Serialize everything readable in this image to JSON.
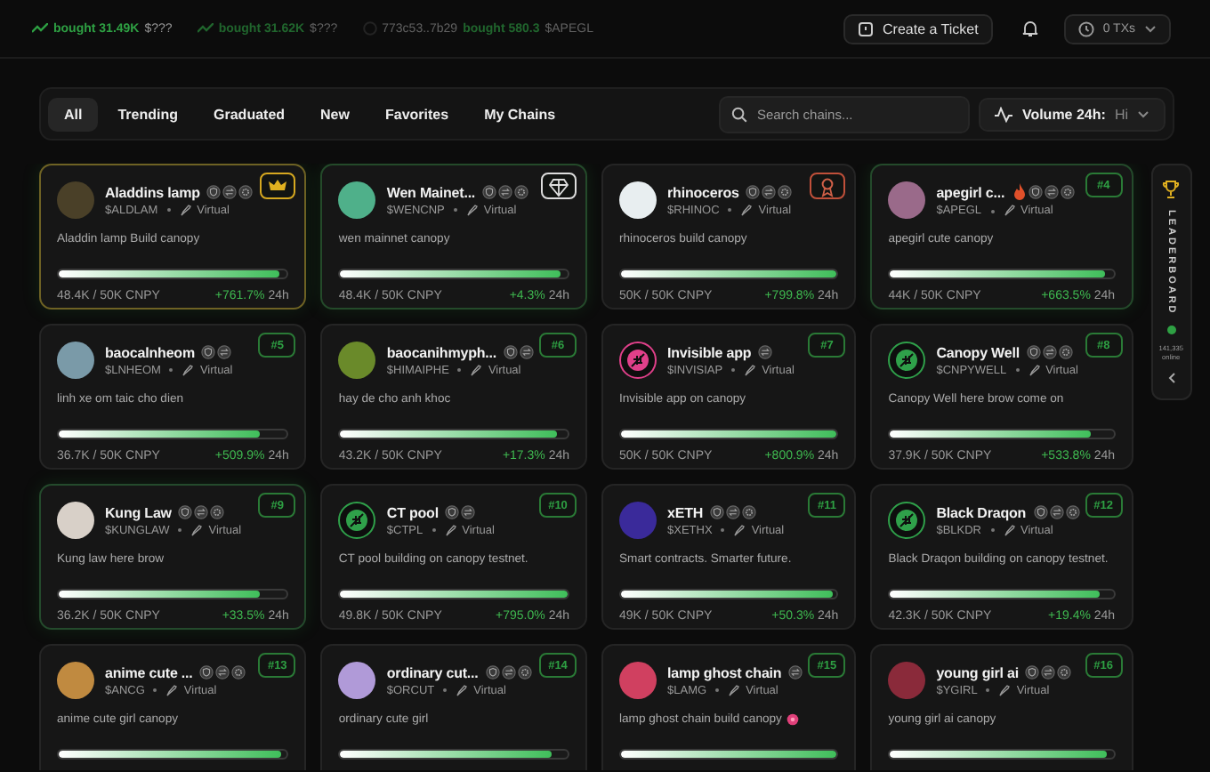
{
  "ticker": [
    {
      "kind": "trend",
      "action": "bought 31.49K",
      "symbol": "$???",
      "faded": false
    },
    {
      "kind": "trend",
      "action": "bought 31.62K",
      "symbol": "$???",
      "faded": true
    },
    {
      "kind": "wallet",
      "address": "773c53..7b29",
      "action": "bought 580.3",
      "symbol": "$APEGL",
      "faded": true
    }
  ],
  "header": {
    "ticket_button": "Create a Ticket",
    "tx_button": "0 TXs"
  },
  "tabs": [
    {
      "label": "All",
      "selected": true
    },
    {
      "label": "Trending",
      "selected": false
    },
    {
      "label": "Graduated",
      "selected": false
    },
    {
      "label": "New",
      "selected": false
    },
    {
      "label": "Favorites",
      "selected": false
    },
    {
      "label": "My Chains",
      "selected": false
    }
  ],
  "search": {
    "placeholder": "Search chains..."
  },
  "sort": {
    "label": "Volume 24h:",
    "value": "Hi"
  },
  "cards": [
    {
      "name": "Aladdins lamp",
      "ticker": "$ALDLAM",
      "type": "Virtual",
      "badges": [
        {
          "kind": "shield"
        },
        {
          "kind": "swap"
        },
        {
          "kind": "gear"
        }
      ],
      "hot": false,
      "avatar": {
        "kind": "photo",
        "color": "#4a4028"
      },
      "rank": {
        "kind": "crown"
      },
      "color": "#6e6224",
      "description": "Aladdin lamp Build canopy",
      "level": 0.968,
      "amount": "48.4K / 50K CNPY",
      "change": "+761.7%",
      "period": "24h"
    },
    {
      "name": "Wen Mainet...",
      "ticker": "$WENCNP",
      "type": "Virtual",
      "badges": [
        {
          "kind": "shield"
        },
        {
          "kind": "swap"
        },
        {
          "kind": "gear"
        }
      ],
      "hot": false,
      "avatar": {
        "kind": "photo",
        "color": "#4fb08a"
      },
      "rank": {
        "kind": "diamond"
      },
      "color": "#244a2a",
      "description": "wen mainnet canopy",
      "level": 0.968,
      "amount": "48.4K / 50K CNPY",
      "change": "+4.3%",
      "period": "24h"
    },
    {
      "name": "rhinoceros",
      "ticker": "$RHINOC",
      "type": "Virtual",
      "badges": [
        {
          "kind": "shield"
        },
        {
          "kind": "swap"
        },
        {
          "kind": "gear"
        }
      ],
      "hot": false,
      "avatar": {
        "kind": "photo",
        "color": "#e8eef0"
      },
      "rank": {
        "kind": "ribbon"
      },
      "description": "rhinoceros build canopy",
      "level": 1,
      "amount": "50K / 50K CNPY",
      "change": "+799.8%",
      "period": "24h"
    },
    {
      "name": "apegirl c...",
      "ticker": "$APEGL",
      "type": "Virtual",
      "badges": [
        {
          "kind": "shield"
        },
        {
          "kind": "swap"
        },
        {
          "kind": "gear"
        }
      ],
      "hot": true,
      "avatar": {
        "kind": "photo",
        "color": "#9a6a8a"
      },
      "rank": {
        "kind": "number",
        "text": "#4"
      },
      "color": "#244a2b",
      "description": "apegirl cute canopy",
      "level": 0.96,
      "amount": "44K / 50K CNPY",
      "change": "+663.5%",
      "period": "24h"
    },
    {
      "name": "baocalnheom",
      "ticker": "$LNHEOM",
      "type": "Virtual",
      "badges": [
        {
          "kind": "shield"
        },
        {
          "kind": "swap"
        }
      ],
      "hot": false,
      "avatar": {
        "kind": "photo",
        "color": "#7a9aa8"
      },
      "rank": {
        "kind": "number",
        "text": "#5"
      },
      "description": "linh xe om taic cho dien",
      "level": 0.88,
      "amount": "36.7K / 50K CNPY",
      "change": "+509.9%",
      "period": "24h"
    },
    {
      "name": "baocanihmyph...",
      "ticker": "$HIMAIPHE",
      "type": "Virtual",
      "badges": [
        {
          "kind": "shield"
        },
        {
          "kind": "swap"
        }
      ],
      "hot": false,
      "avatar": {
        "kind": "photo",
        "color": "#6a8a2a"
      },
      "rank": {
        "kind": "number",
        "text": "#6"
      },
      "description": "hay de cho anh khoc",
      "level": 0.95,
      "amount": "43.2K / 50K CNPY",
      "change": "+17.3%",
      "period": "24h"
    },
    {
      "name": "Invisible app",
      "ticker": "$INVISIAP",
      "type": "Virtual",
      "badges": [
        {
          "kind": "swap"
        }
      ],
      "hot": false,
      "avatar": {
        "kind": "leaf",
        "color": "#e0408a"
      },
      "rank": {
        "kind": "number",
        "text": "#7"
      },
      "description": "Invisible app on canopy",
      "level": 1,
      "amount": "50K / 50K CNPY",
      "change": "+800.9%",
      "period": "24h"
    },
    {
      "name": "Canopy Well",
      "ticker": "$CNPYWELL",
      "type": "Virtual",
      "badges": [
        {
          "kind": "shield"
        },
        {
          "kind": "swap"
        },
        {
          "kind": "gear"
        }
      ],
      "hot": false,
      "avatar": {
        "kind": "leaf",
        "color": "#2fa04a"
      },
      "rank": {
        "kind": "number",
        "text": "#8"
      },
      "description": "Canopy Well here brow come on",
      "level": 0.9,
      "amount": "37.9K / 50K CNPY",
      "change": "+533.8%",
      "period": "24h"
    },
    {
      "name": "Kung Law",
      "ticker": "$KUNGLAW",
      "type": "Virtual",
      "badges": [
        {
          "kind": "shield"
        },
        {
          "kind": "swap"
        },
        {
          "kind": "gear"
        }
      ],
      "hot": false,
      "avatar": {
        "kind": "photo",
        "color": "#d8d0c8"
      },
      "rank": {
        "kind": "number",
        "text": "#9"
      },
      "color": "#244a2c",
      "description": "Kung law here brow",
      "level": 0.88,
      "amount": "36.2K / 50K CNPY",
      "change": "+33.5%",
      "period": "24h"
    },
    {
      "name": "CT pool",
      "ticker": "$CTPL",
      "type": "Virtual",
      "badges": [
        {
          "kind": "shield"
        },
        {
          "kind": "swap"
        }
      ],
      "hot": false,
      "avatar": {
        "kind": "leaf",
        "color": "#2fa04a"
      },
      "rank": {
        "kind": "number",
        "text": "#10"
      },
      "description": "CT pool building on canopy testnet.",
      "level": 1,
      "amount": "49.8K / 50K CNPY",
      "change": "+795.0%",
      "period": "24h"
    },
    {
      "name": "xETH",
      "ticker": "$XETHX",
      "type": "Virtual",
      "badges": [
        {
          "kind": "shield"
        },
        {
          "kind": "swap"
        },
        {
          "kind": "gear"
        }
      ],
      "hot": false,
      "avatar": {
        "kind": "photo",
        "color": "#3a2a9a"
      },
      "rank": {
        "kind": "number",
        "text": "#11"
      },
      "description": "Smart contracts. Smarter future.",
      "level": 0.98,
      "amount": "49K / 50K CNPY",
      "change": "+50.3%",
      "period": "24h"
    },
    {
      "name": "Black Draqon",
      "ticker": "$BLKDR",
      "type": "Virtual",
      "badges": [
        {
          "kind": "shield"
        },
        {
          "kind": "swap"
        },
        {
          "kind": "gear"
        }
      ],
      "hot": false,
      "avatar": {
        "kind": "leaf",
        "color": "#2fa04a"
      },
      "rank": {
        "kind": "number",
        "text": "#12"
      },
      "description": "Black Draqon building on canopy testnet.",
      "level": 0.94,
      "amount": "42.3K / 50K CNPY",
      "change": "+19.4%",
      "period": "24h"
    },
    {
      "name": "anime cute ...",
      "ticker": "$ANCG",
      "type": "Virtual",
      "badges": [
        {
          "kind": "shield"
        },
        {
          "kind": "swap"
        },
        {
          "kind": "gear"
        }
      ],
      "hot": false,
      "avatar": {
        "kind": "photo",
        "color": "#c08a40"
      },
      "rank": {
        "kind": "number",
        "text": "#13"
      },
      "description": "anime cute girl canopy",
      "level": 0.97
    },
    {
      "name": "ordinary cut...",
      "ticker": "$ORCUT",
      "type": "Virtual",
      "badges": [
        {
          "kind": "shield"
        },
        {
          "kind": "swap"
        },
        {
          "kind": "gear"
        }
      ],
      "hot": false,
      "avatar": {
        "kind": "photo",
        "color": "#b09ad8"
      },
      "rank": {
        "kind": "number",
        "text": "#14"
      },
      "description": "ordinary cute girl",
      "level": 0.93
    },
    {
      "name": "lamp ghost chain",
      "ticker": "$LAMG",
      "type": "Virtual",
      "badges": [
        {
          "kind": "swap"
        }
      ],
      "hot": false,
      "desc_icon": {
        "kind": "flower"
      },
      "avatar": {
        "kind": "photo",
        "color": "#d04060"
      },
      "rank": {
        "kind": "number",
        "text": "#15"
      },
      "description": "lamp ghost chain build canopy",
      "level": 1
    },
    {
      "name": "young girl ai",
      "ticker": "$YGIRL",
      "type": "Virtual",
      "badges": [
        {
          "kind": "shield"
        },
        {
          "kind": "swap"
        },
        {
          "kind": "gear"
        }
      ],
      "hot": false,
      "avatar": {
        "kind": "photo",
        "color": "#8a2a3a"
      },
      "rank": {
        "kind": "number",
        "text": "#16"
      },
      "description": "young girl ai canopy",
      "level": 0.97
    }
  ],
  "leaderboard": {
    "title": "LEADERBOARD",
    "count": "141,335",
    "status": "online"
  }
}
